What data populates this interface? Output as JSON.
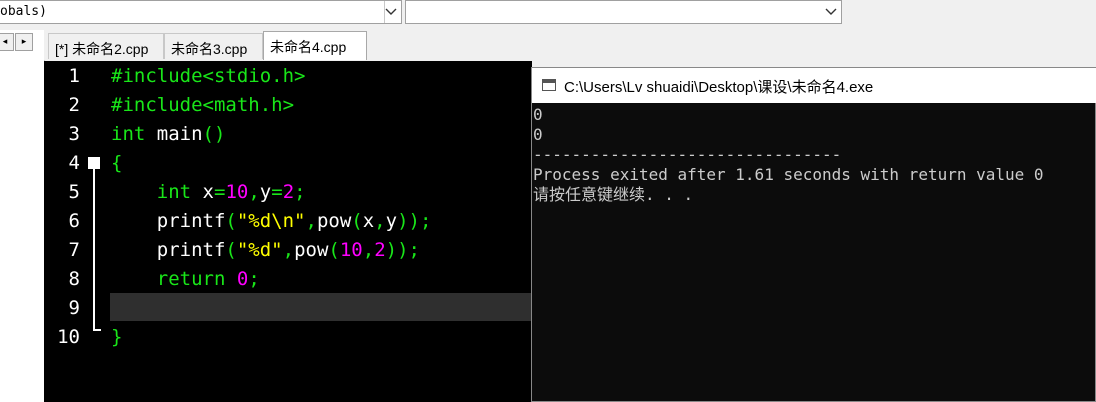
{
  "toolbar": {
    "combo1_text": "obals)",
    "combo2_text": ""
  },
  "nav": {
    "prev": "◂",
    "next": "▸"
  },
  "tabs": [
    {
      "label": "[*] 未命名2.cpp"
    },
    {
      "label": "未命名3.cpp"
    },
    {
      "label": "未命名4.cpp"
    }
  ],
  "editor": {
    "line_numbers": [
      "1",
      "2",
      "3",
      "4",
      "5",
      "6",
      "7",
      "8",
      "9",
      "10"
    ],
    "lines": [
      [
        {
          "t": "#include<stdio.h>",
          "c": "pre"
        }
      ],
      [
        {
          "t": "#include<math.h>",
          "c": "pre"
        }
      ],
      [
        {
          "t": "int",
          "c": "kw"
        },
        {
          "t": " main",
          "c": "id"
        },
        {
          "t": "()",
          "c": "op"
        }
      ],
      [
        {
          "t": "{",
          "c": "op"
        }
      ],
      [
        {
          "t": "    ",
          "c": "id"
        },
        {
          "t": "int",
          "c": "kw"
        },
        {
          "t": " x",
          "c": "id"
        },
        {
          "t": "=",
          "c": "op"
        },
        {
          "t": "10",
          "c": "num"
        },
        {
          "t": ",",
          "c": "op"
        },
        {
          "t": "y",
          "c": "id"
        },
        {
          "t": "=",
          "c": "op"
        },
        {
          "t": "2",
          "c": "num"
        },
        {
          "t": ";",
          "c": "op"
        }
      ],
      [
        {
          "t": "    printf",
          "c": "id"
        },
        {
          "t": "(",
          "c": "op"
        },
        {
          "t": "\"%d\\n\"",
          "c": "str"
        },
        {
          "t": ",",
          "c": "op"
        },
        {
          "t": "pow",
          "c": "id"
        },
        {
          "t": "(",
          "c": "op"
        },
        {
          "t": "x",
          "c": "id"
        },
        {
          "t": ",",
          "c": "op"
        },
        {
          "t": "y",
          "c": "id"
        },
        {
          "t": "));",
          "c": "op"
        }
      ],
      [
        {
          "t": "    printf",
          "c": "id"
        },
        {
          "t": "(",
          "c": "op"
        },
        {
          "t": "\"%d\"",
          "c": "str"
        },
        {
          "t": ",",
          "c": "op"
        },
        {
          "t": "pow",
          "c": "id"
        },
        {
          "t": "(",
          "c": "op"
        },
        {
          "t": "10",
          "c": "num"
        },
        {
          "t": ",",
          "c": "op"
        },
        {
          "t": "2",
          "c": "num"
        },
        {
          "t": "));",
          "c": "op"
        }
      ],
      [
        {
          "t": "    ",
          "c": "id"
        },
        {
          "t": "return",
          "c": "kw"
        },
        {
          "t": " ",
          "c": "id"
        },
        {
          "t": "0",
          "c": "num"
        },
        {
          "t": ";",
          "c": "op"
        }
      ],
      [],
      [
        {
          "t": "}",
          "c": "op"
        }
      ]
    ]
  },
  "console": {
    "title": "C:\\Users\\Lv shuaidi\\Desktop\\课设\\未命名4.exe",
    "lines": [
      "0",
      "0",
      "--------------------------------",
      "Process exited after 1.61 seconds with return value 0",
      "请按任意键继续. . ."
    ]
  },
  "colors": {
    "preprocessor": "#19e619",
    "keyword": "#19e619",
    "number": "#ff00ff",
    "string": "#ffff00",
    "editor_bg": "#000000",
    "console_bg": "#0c0c0c"
  },
  "icons": {
    "dropdown": "chevron-down-icon",
    "console": "console-window-icon"
  }
}
